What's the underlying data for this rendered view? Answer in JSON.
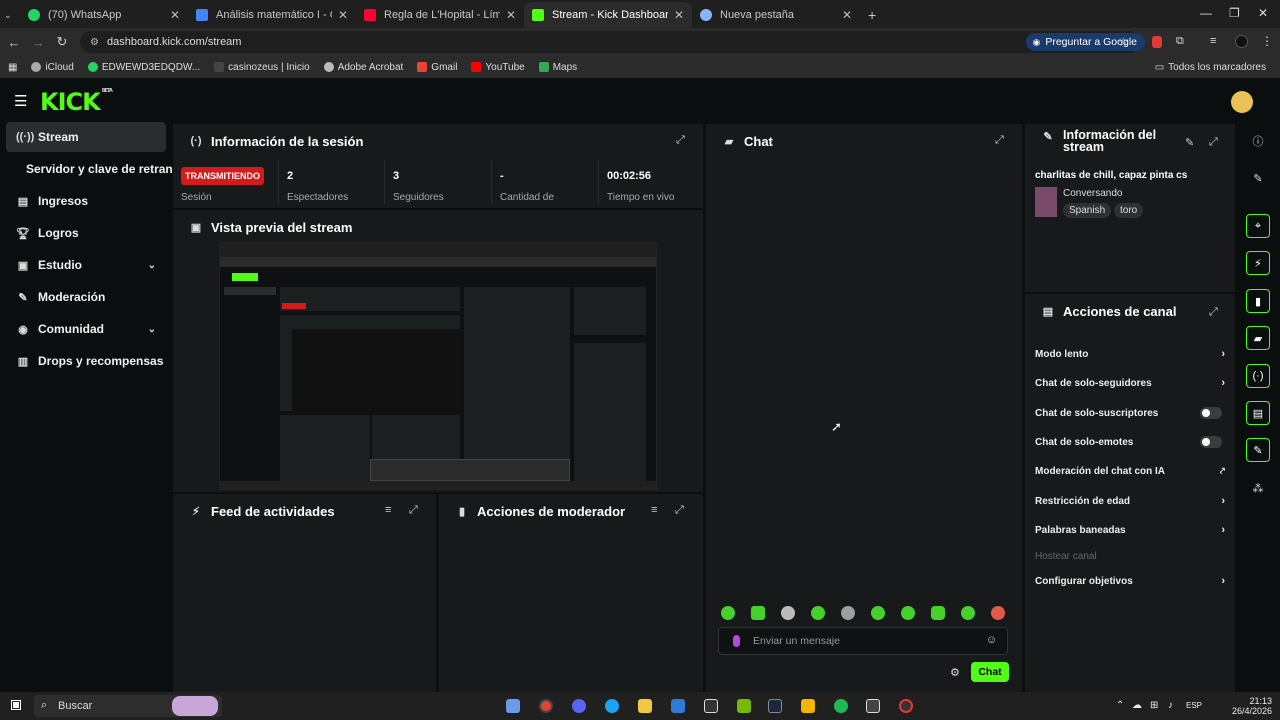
{
  "browser": {
    "tabs": [
      {
        "title": "(70) WhatsApp",
        "color": "#25d366"
      },
      {
        "title": "Análisis matemático I - Google",
        "color": "#4285f4"
      },
      {
        "title": "Regla de L'Hopital - Límites - Y",
        "color": "#ff0033"
      },
      {
        "title": "Stream - Kick Dashboard",
        "color": "#53fc18"
      },
      {
        "title": "Nueva pestaña",
        "color": "#8ab4f8"
      }
    ],
    "url": "dashboard.kick.com/stream",
    "gemini_button": "Preguntar a Google",
    "bookmarks": [
      {
        "label": "iCloud",
        "color": "#aaaaaa"
      },
      {
        "label": "EDWEWD3EDQDW...",
        "color": "#25d366"
      },
      {
        "label": "casinozeus | Inicio",
        "color": "#444444"
      },
      {
        "label": "Adobe Acrobat",
        "color": "#bbbbbb"
      },
      {
        "label": "Gmail",
        "color": "#ea4335"
      },
      {
        "label": "YouTube",
        "color": "#ff0000"
      },
      {
        "label": "Maps",
        "color": "#34a853"
      }
    ],
    "all_bookmarks": "Todos los marcadores"
  },
  "kick": {
    "logo": "KICK",
    "logo_badge": "BETA"
  },
  "sidebar": {
    "items": [
      {
        "label": "Stream",
        "icon": "broadcast-icon"
      },
      {
        "label": "Servidor y clave de retransmisión",
        "icon": ""
      },
      {
        "label": "Ingresos",
        "icon": "chart-icon"
      },
      {
        "label": "Logros",
        "icon": "trophy-icon"
      },
      {
        "label": "Estudio",
        "icon": "studio-icon"
      },
      {
        "label": "Moderación",
        "icon": "wrench-icon"
      },
      {
        "label": "Comunidad",
        "icon": "people-icon"
      },
      {
        "label": "Drops y recompensas",
        "icon": "gift-icon"
      }
    ]
  },
  "session": {
    "title": "Información de la sesión",
    "live_badge": "TRANSMITIENDO",
    "session_label": "Sesión",
    "stats": [
      {
        "value": "2",
        "label": "Espectadores"
      },
      {
        "value": "3",
        "label": "Seguidores"
      },
      {
        "value": "-",
        "label": "Cantidad de"
      },
      {
        "value": "00:02:56",
        "label": "Tiempo en vivo"
      }
    ]
  },
  "preview": {
    "title": "Vista previa del stream"
  },
  "feed": {
    "title": "Feed de actividades"
  },
  "mod_actions": {
    "title": "Acciones de moderador"
  },
  "chat": {
    "title": "Chat",
    "placeholder": "Enviar un mensaje",
    "send": "Chat"
  },
  "stream_info": {
    "title": "Información del stream",
    "stream_title": "charlitas de chill, capaz pinta cs",
    "category": "Conversando",
    "tags": [
      "Spanish",
      "toro"
    ]
  },
  "channel_actions": {
    "title": "Acciones de canal",
    "items": [
      {
        "label": "Modo lento",
        "kind": "arrow"
      },
      {
        "label": "Chat de solo-seguidores",
        "kind": "arrow"
      },
      {
        "label": "Chat de solo-suscriptores",
        "kind": "toggle"
      },
      {
        "label": "Chat de solo-emotes",
        "kind": "toggle"
      },
      {
        "label": "Moderación del chat con IA",
        "kind": "external"
      },
      {
        "label": "Restricción de edad",
        "kind": "arrow"
      },
      {
        "label": "Palabras baneadas",
        "kind": "arrow"
      },
      {
        "label": "Hostear canal",
        "kind": "disabled"
      },
      {
        "label": "Configurar objetivos",
        "kind": "arrow"
      }
    ]
  },
  "taskbar": {
    "search": "Buscar",
    "lang": "ESP",
    "time": "21:13",
    "date": "26/4/2026"
  }
}
